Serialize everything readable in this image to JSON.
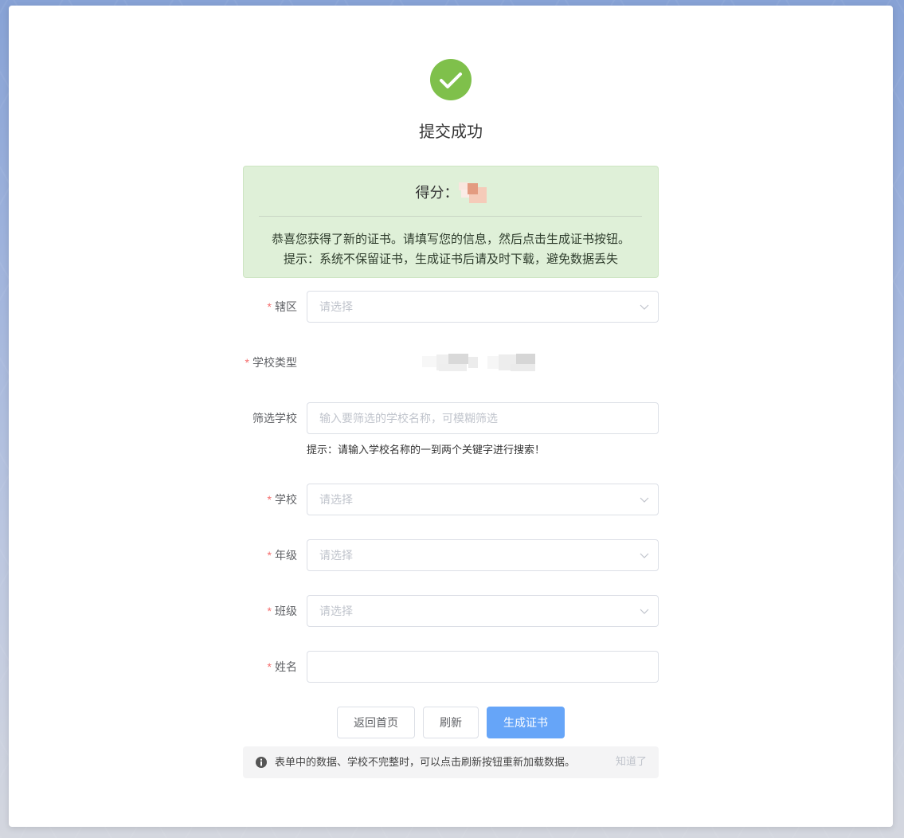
{
  "result": {
    "title": "提交成功",
    "score_label": "得分：",
    "message_lines": [
      "恭喜您获得了新的证书。请填写您的信息，然后点击生成证书按钮。",
      "提示：系统不保留证书，生成证书后请及时下载，避免数据丢失"
    ]
  },
  "form": {
    "required_mark": "*",
    "district": {
      "label": "辖区",
      "placeholder": "请选择",
      "required": true
    },
    "school_type": {
      "label": "学校类型",
      "required": true
    },
    "school_filter": {
      "label": "筛选学校",
      "placeholder": "输入要筛选的学校名称，可模糊筛选",
      "value": "",
      "hint": "提示：请输入学校名称的一到两个关键字进行搜索！",
      "required": false
    },
    "school": {
      "label": "学校",
      "placeholder": "请选择",
      "required": true
    },
    "grade": {
      "label": "年级",
      "placeholder": "请选择",
      "required": true
    },
    "class": {
      "label": "班级",
      "placeholder": "请选择",
      "required": true
    },
    "name": {
      "label": "姓名",
      "value": "",
      "required": true
    }
  },
  "actions": {
    "home": "返回首页",
    "refresh": "刷新",
    "generate": "生成证书"
  },
  "notice": {
    "text": "表单中的数据、学校不完整时，可以点击刷新按钮重新加载数据。",
    "dismiss": "知道了"
  },
  "icons": {
    "success": "check-circle-icon",
    "select_arrow": "chevron-down-icon",
    "notice": "info-icon"
  },
  "colors": {
    "accent": "#66a5f8",
    "success": "#7fc04b",
    "success_bg": "#dff0d8",
    "required": "#f56c6c"
  }
}
